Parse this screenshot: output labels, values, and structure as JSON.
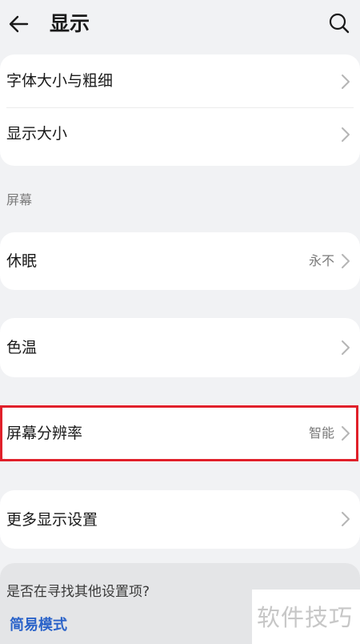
{
  "header": {
    "title": "显示",
    "back_icon": "back-arrow-icon",
    "search_icon": "search-icon"
  },
  "cards": {
    "font_size": {
      "label": "字体大小与粗细"
    },
    "display_size": {
      "label": "显示大小"
    },
    "sleep": {
      "label": "休眠",
      "value": "永不"
    },
    "color_temp": {
      "label": "色温"
    },
    "resolution": {
      "label": "屏幕分辨率",
      "value": "智能"
    },
    "more_display": {
      "label": "更多显示设置"
    }
  },
  "sections": {
    "screen_title": "屏幕"
  },
  "bottom": {
    "prompt": "是否在寻找其他设置项?",
    "simple_mode": "简易模式"
  },
  "watermark": "软件技巧",
  "colors": {
    "background": "#f1f2f4",
    "card": "#ffffff",
    "highlight_border": "#e0202a",
    "link": "#2b63c9"
  }
}
